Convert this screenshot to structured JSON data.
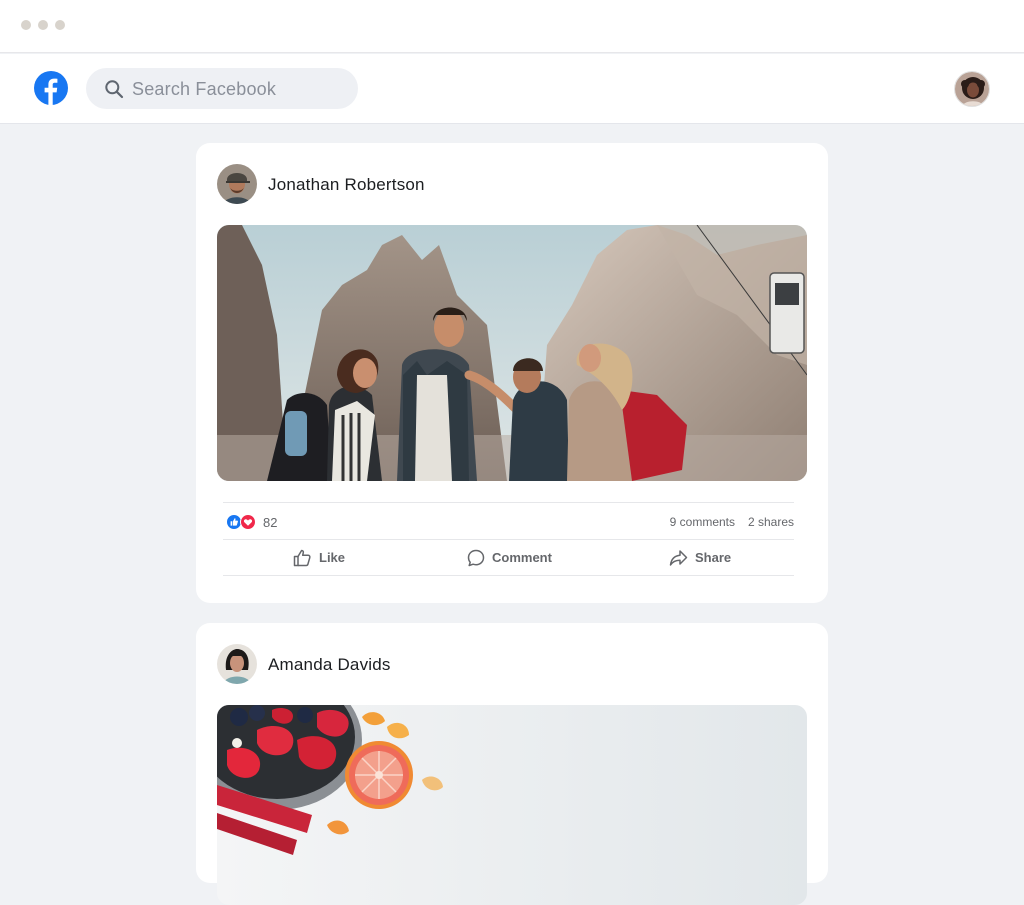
{
  "window": {
    "controls": [
      "close",
      "minimize",
      "maximize"
    ]
  },
  "topbar": {
    "logo_icon": "facebook-logo-icon",
    "search": {
      "placeholder": "Search Facebook",
      "icon": "search-icon"
    },
    "avatar_icon": "user-avatar"
  },
  "colors": {
    "brand": "#1877f2",
    "background": "#f0f2f5",
    "like_reaction": "#1877f2",
    "love_reaction": "#f0284a"
  },
  "posts": [
    {
      "author": "Jonathan Robertson",
      "image": "friends-hiking-mountains-photo",
      "reactions": {
        "icons": [
          "like-reaction-icon",
          "love-reaction-icon"
        ],
        "count": "82"
      },
      "comments": "9 comments",
      "shares": "2 shares",
      "actions": {
        "like": "Like",
        "comment": "Comment",
        "share": "Share"
      }
    },
    {
      "author": "Amanda Davids",
      "image": "fruit-bowl-photo"
    }
  ]
}
